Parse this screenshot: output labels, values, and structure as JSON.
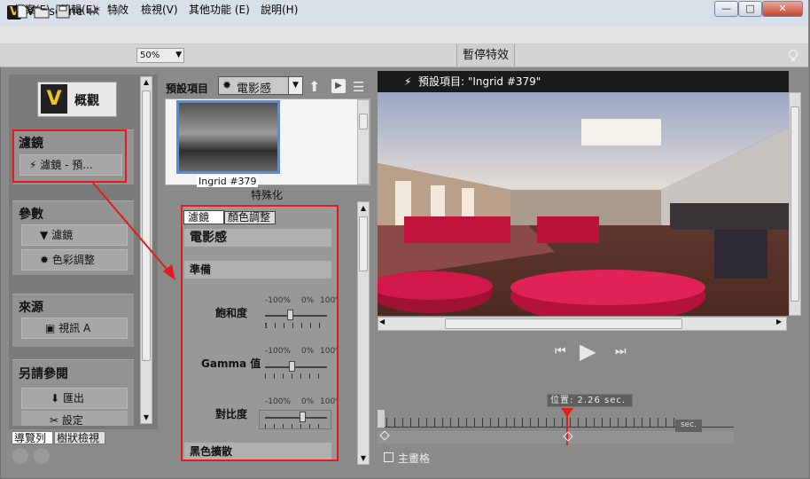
{
  "window": {
    "title": "Vitascene - *",
    "app_initial": "V",
    "minimize": "—",
    "maximize": "□",
    "close": "✕"
  },
  "menu": [
    "檔案(F)",
    "編輯(E)",
    "特效",
    "檢視(V)",
    "其他功能 (E)",
    "說明(H)"
  ],
  "toolbar": {
    "zoom": "50%",
    "pause_label": "暫停特效"
  },
  "left": {
    "overview_label": "概觀",
    "logo_letter": "V",
    "filter_heading": "濾鏡",
    "filter_item": "濾鏡 - 預...",
    "params_heading": "參數",
    "params_items": [
      "濾鏡",
      "色彩調整"
    ],
    "source_heading": "來源",
    "source_item": "視訊 A",
    "see_also_heading": "另請參閱",
    "see_also_items": [
      "匯出",
      "設定"
    ],
    "tabs": [
      "導覽列",
      "樹狀檢視"
    ]
  },
  "middle": {
    "preset_label": "預設項目",
    "preset_value": "電影感",
    "thumb_label": "Ingrid #379",
    "thumb_caption": "特殊化",
    "tabs": [
      "濾鏡",
      "顏色調整"
    ],
    "section_title": "電影感",
    "subsection": "準備",
    "sliders": [
      {
        "label": "飽和度",
        "min": "-100%",
        "mid": "0%",
        "max": "100%",
        "value_percent": -20
      },
      {
        "label": "Gamma 值",
        "min": "-100%",
        "mid": "0%",
        "max": "100%",
        "value_percent": -15
      },
      {
        "label": "對比度",
        "min": "-100%",
        "mid": "0%",
        "max": "100%",
        "value_percent": 20
      }
    ],
    "next_section": "黑色擴散"
  },
  "preview": {
    "header": "預設項目:  \"Ingrid #379\"",
    "position_label": "位置: 2.26 sec.",
    "sec_label": "sec.",
    "main_track_label": "主畫格"
  },
  "colors": {
    "highlight": "#e21c1c",
    "selection": "#4b8ef0",
    "logo": "#f5c21b"
  }
}
